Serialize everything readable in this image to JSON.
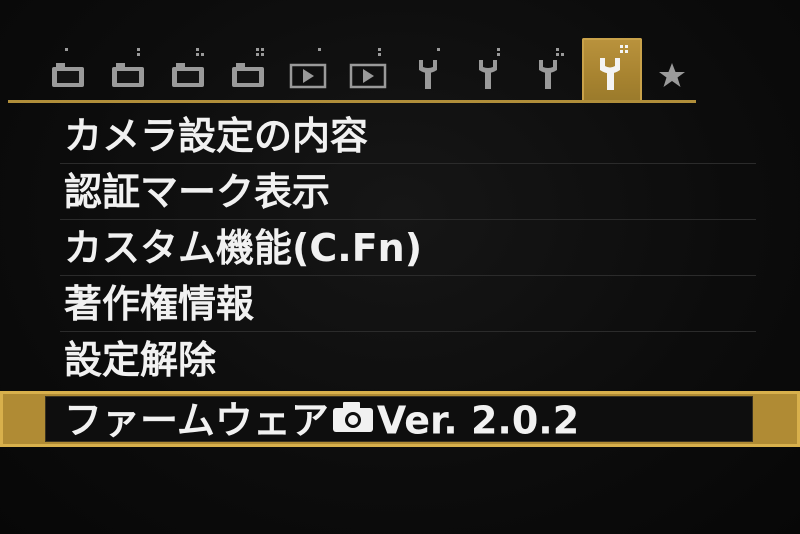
{
  "tabs": [
    {
      "icon": "shooting-camera-icon",
      "dots": 1
    },
    {
      "icon": "shooting-camera-icon",
      "dots": 2
    },
    {
      "icon": "shooting-camera-icon",
      "dots": 3
    },
    {
      "icon": "shooting-camera-icon",
      "dots": 4
    },
    {
      "icon": "playback-icon",
      "dots": 1
    },
    {
      "icon": "playback-icon",
      "dots": 2
    },
    {
      "icon": "setup-wrench-icon",
      "dots": 1
    },
    {
      "icon": "setup-wrench-icon",
      "dots": 2
    },
    {
      "icon": "setup-wrench-icon",
      "dots": 3
    },
    {
      "icon": "setup-wrench-icon",
      "dots": 4,
      "active": true
    },
    {
      "icon": "my-menu-star-icon",
      "dots": 0
    }
  ],
  "menu": {
    "items": [
      {
        "label": "カメラ設定の内容"
      },
      {
        "label": "認証マーク表示"
      },
      {
        "label": "カスタム機能(C.Fn)"
      },
      {
        "label": "著作権情報"
      },
      {
        "label": "設定解除"
      }
    ],
    "firmware": {
      "label": "ファームウェア",
      "icon": "camera-body-icon",
      "version": "Ver. 2.0.2"
    }
  },
  "colors": {
    "accent": "#b08b34",
    "accent_border": "#d8b04c",
    "icon_gray": "#9a9a9a",
    "text": "#f1f1f1",
    "background": "#0c0c0c"
  }
}
